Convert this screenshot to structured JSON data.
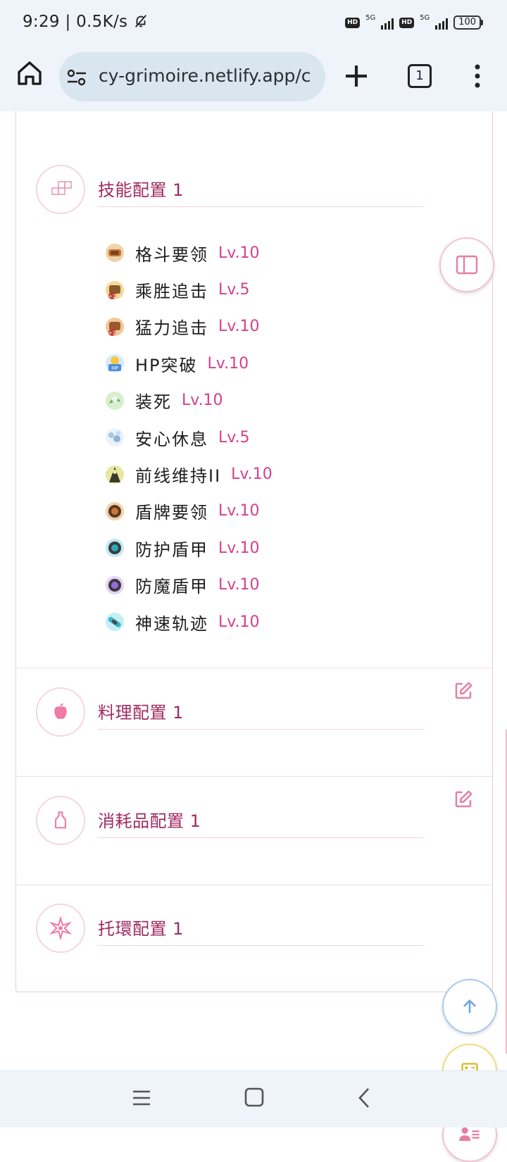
{
  "status_bar": {
    "time_speed": "9:29 | 0.5K/s",
    "icons": [
      "bell-off-icon",
      "hd-icon",
      "signal-5g-icon",
      "hd-icon",
      "signal-5g-icon"
    ],
    "net1": "5G",
    "net2": "5G",
    "hd": "HD",
    "battery": "100"
  },
  "browser": {
    "url": "cy-grimoire.netlify.app/c",
    "tab_count": "1"
  },
  "sections": {
    "skills": {
      "title": "技能配置 1",
      "icon": "grid-blocks-icon",
      "items": [
        {
          "name": "格斗要领",
          "level": "Lv.10",
          "icon": "fight-skill-icon",
          "color": "#c7783c"
        },
        {
          "name": "乘胜追击",
          "level": "Lv.5",
          "icon": "pursuit-skill-icon",
          "color": "#8a5a2b"
        },
        {
          "name": "猛力追击",
          "level": "Lv.10",
          "icon": "power-pursuit-skill-icon",
          "color": "#9c5a2c"
        },
        {
          "name": "HP突破",
          "level": "Lv.10",
          "icon": "hp-boost-skill-icon",
          "color": "#4d8fd8"
        },
        {
          "name": "装死",
          "level": "Lv.10",
          "icon": "play-dead-skill-icon",
          "color": "#6aa35a"
        },
        {
          "name": "安心休息",
          "level": "Lv.5",
          "icon": "rest-skill-icon",
          "color": "#8fb4d8"
        },
        {
          "name": "前线维持II",
          "level": "Lv.10",
          "icon": "frontline-skill-icon",
          "color": "#3a3a2a"
        },
        {
          "name": "盾牌要领",
          "level": "Lv.10",
          "icon": "shield-skill-icon",
          "color": "#c7783c"
        },
        {
          "name": "防护盾甲",
          "level": "Lv.10",
          "icon": "guard-shield-skill-icon",
          "color": "#2aa9b8"
        },
        {
          "name": "防魔盾甲",
          "level": "Lv.10",
          "icon": "magic-shield-skill-icon",
          "color": "#9a6ad8"
        },
        {
          "name": "神速轨迹",
          "level": "Lv.10",
          "icon": "speed-skill-icon",
          "color": "#35b5c8"
        }
      ]
    },
    "food": {
      "title": "料理配置 1",
      "icon": "apple-icon"
    },
    "consumables": {
      "title": "消耗品配置 1",
      "icon": "potion-bottle-icon"
    },
    "registlet": {
      "title": "托環配置 1",
      "icon": "star-burst-icon"
    }
  },
  "colors": {
    "accent": "#d5408a",
    "title": "#a02a62",
    "border": "#f3c6d3",
    "chrome_bg": "#eef4fa"
  }
}
